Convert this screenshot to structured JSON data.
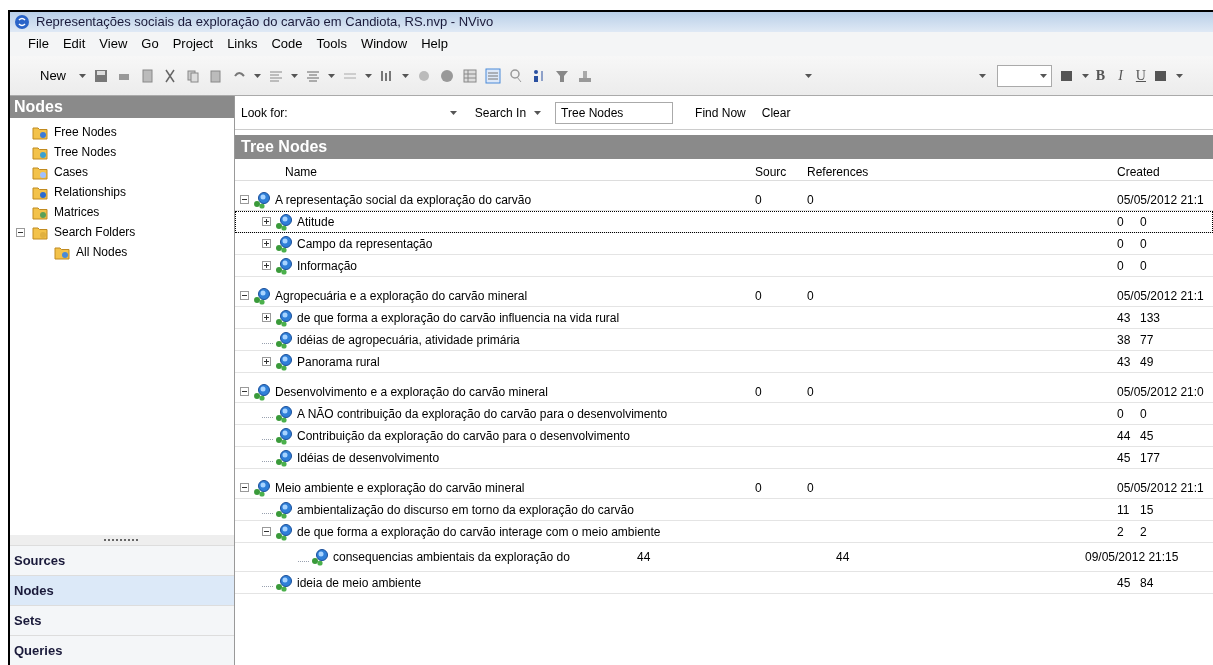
{
  "window": {
    "title": "Representações sociais da exploração do carvão em Candiota, RS.nvp - NVivo"
  },
  "menu": [
    "File",
    "Edit",
    "View",
    "Go",
    "Project",
    "Links",
    "Code",
    "Tools",
    "Window",
    "Help"
  ],
  "toolbar": {
    "new_label": "New",
    "bold": "B",
    "italic": "I",
    "underline": "U"
  },
  "sidebar": {
    "title": "Nodes",
    "items": [
      {
        "label": "Free Nodes",
        "kind": "free"
      },
      {
        "label": "Tree Nodes",
        "kind": "tree"
      },
      {
        "label": "Cases",
        "kind": "cases"
      },
      {
        "label": "Relationships",
        "kind": "relationships"
      },
      {
        "label": "Matrices",
        "kind": "matrices"
      },
      {
        "label": "Search Folders",
        "kind": "search",
        "expanded": true,
        "children": [
          {
            "label": "All Nodes",
            "kind": "all"
          }
        ]
      }
    ],
    "nav": [
      {
        "label": "Sources",
        "selected": false
      },
      {
        "label": "Nodes",
        "selected": true
      },
      {
        "label": "Sets",
        "selected": false
      },
      {
        "label": "Queries",
        "selected": false
      }
    ]
  },
  "search": {
    "look_for_label": "Look for:",
    "search_in": "Search In",
    "scope": "Tree Nodes",
    "find_now": "Find Now",
    "clear": "Clear"
  },
  "panel": {
    "title": "Tree Nodes",
    "columns": [
      "Name",
      "Sourc",
      "References",
      "Created"
    ],
    "rows": [
      {
        "kind": "group",
        "name": "A representação social da exploração do carvão",
        "sourc": "0",
        "references": "0",
        "created": "05/05/2012 21:1",
        "expanded": true,
        "selected": false,
        "children": [
          {
            "kind": "child",
            "name": "Atitude",
            "cells": [
              "0",
              "0"
            ],
            "expanded": false,
            "selected": true
          },
          {
            "kind": "child",
            "name": "Campo da representação",
            "cells": [
              "0",
              "0"
            ],
            "expanded": false,
            "selected": false
          },
          {
            "kind": "child",
            "name": "Informação",
            "cells": [
              "0",
              "0"
            ],
            "expanded": false,
            "selected": false
          }
        ]
      },
      {
        "kind": "group",
        "name": "Agropecuária e a exploração do carvão mineral",
        "sourc": "0",
        "references": "0",
        "created": "05/05/2012 21:1",
        "expanded": true,
        "selected": false,
        "children": [
          {
            "kind": "child",
            "name": "de que forma a exploração do carvão influencia na vida rural",
            "cells": [
              "43",
              "133"
            ],
            "expanded": false,
            "selected": false
          },
          {
            "kind": "child",
            "name": "idéias de agropecuária, atividade primária",
            "cells": [
              "38",
              "77"
            ],
            "selected": false
          },
          {
            "kind": "child",
            "name": "Panorama rural",
            "cells": [
              "43",
              "49"
            ],
            "expanded": false,
            "selected": false
          }
        ]
      },
      {
        "kind": "group",
        "name": "Desenvolvimento e a exploração do carvão mineral",
        "sourc": "0",
        "references": "0",
        "created": "05/05/2012 21:0",
        "expanded": true,
        "selected": false,
        "children": [
          {
            "kind": "child",
            "name": "A NÃO contribuição da exploração do carvão para o desenvolvimento",
            "cells": [
              "0",
              "0"
            ],
            "selected": false
          },
          {
            "kind": "child",
            "name": "Contribuição da exploração do carvão para o desenvolvimento",
            "cells": [
              "44",
              "45"
            ],
            "selected": false
          },
          {
            "kind": "child",
            "name": "Idéias de desenvolvimento",
            "cells": [
              "45",
              "177"
            ],
            "selected": false
          }
        ]
      },
      {
        "kind": "group",
        "name": "Meio ambiente e exploração do carvão mineral",
        "sourc": "0",
        "references": "0",
        "created": "05/05/2012 21:1",
        "expanded": true,
        "selected": false,
        "children": [
          {
            "kind": "child",
            "name": "ambientalização do discurso em torno da exploração do carvão",
            "cells": [
              "11",
              "15"
            ],
            "selected": false
          },
          {
            "kind": "child",
            "name": "de que forma a exploração do carvão interage com o meio ambiente",
            "cells": [
              "2",
              "2"
            ],
            "expanded": true,
            "selected": false,
            "children": [
              {
                "kind": "grandchild",
                "name": "consequencias ambientais da exploração do",
                "cells": [
                  "44",
                  "44",
                  "09/05/2012 21:15"
                ],
                "selected": false
              }
            ]
          },
          {
            "kind": "child",
            "name": "ideia de meio ambiente",
            "cells": [
              "45",
              "84"
            ],
            "selected": false
          }
        ]
      }
    ]
  }
}
